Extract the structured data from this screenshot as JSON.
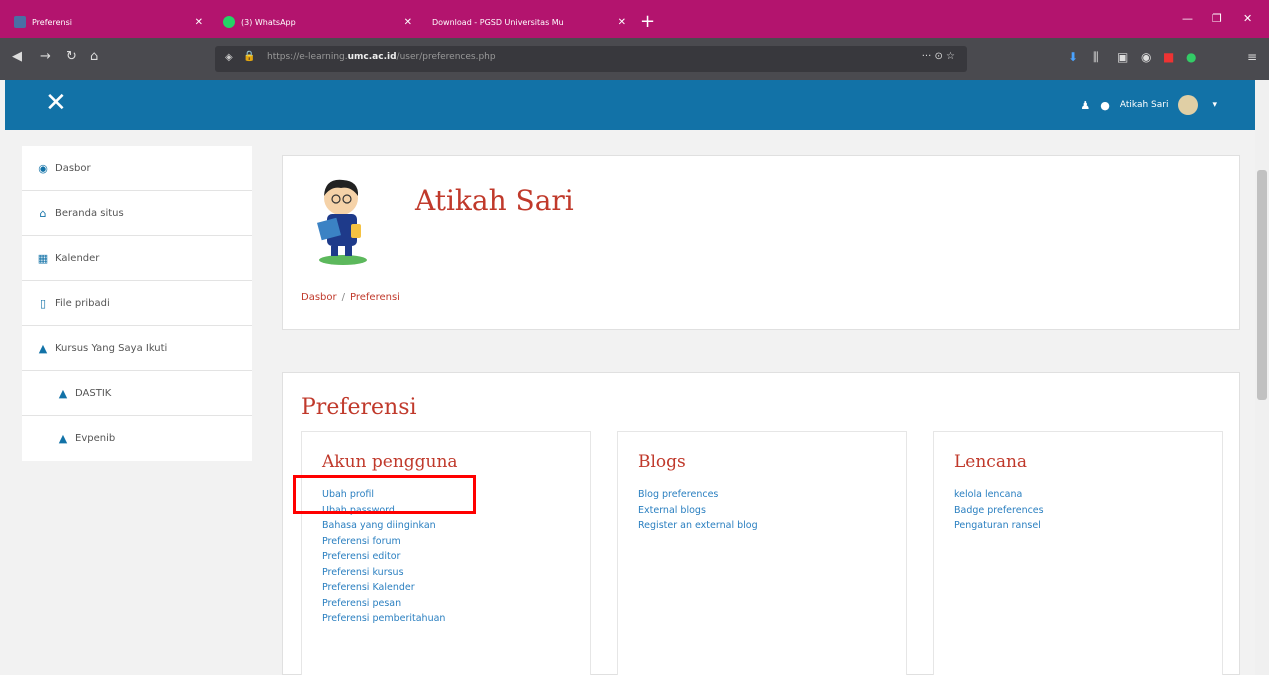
{
  "browser": {
    "tabs": [
      {
        "title": "Preferensi",
        "active": false
      },
      {
        "title": "(3) WhatsApp",
        "active": false
      },
      {
        "title": "Download - PGSD Universitas Mu",
        "active": true
      }
    ],
    "url_prefix": "https://e-learning.",
    "url_domain": "umc.ac.id",
    "url_path": "/user/preferences.php",
    "url_actions": "··· ⊙ ☆"
  },
  "header": {
    "user_name": "Atikah Sari"
  },
  "sidebar": {
    "items": [
      {
        "label": "Dasbor",
        "icon": "dashboard-icon",
        "glyph": "◉"
      },
      {
        "label": "Beranda situs",
        "icon": "home-icon",
        "glyph": "⌂"
      },
      {
        "label": "Kalender",
        "icon": "calendar-icon",
        "glyph": "▦"
      },
      {
        "label": "File pribadi",
        "icon": "file-icon",
        "glyph": "▯"
      },
      {
        "label": "Kursus Yang Saya Ikuti",
        "icon": "graduation-cap-icon",
        "glyph": "▲"
      },
      {
        "label": "DASTIK",
        "icon": "graduation-cap-icon",
        "glyph": "▲"
      },
      {
        "label": "Evpenib",
        "icon": "graduation-cap-icon",
        "glyph": "▲"
      }
    ]
  },
  "page": {
    "user_name": "Atikah Sari",
    "breadcrumb": [
      "Dasbor",
      "Preferensi"
    ],
    "title": "Preferensi"
  },
  "sections": {
    "account": {
      "title": "Akun pengguna",
      "links": [
        "Ubah profil",
        "Ubah password",
        "Bahasa yang diinginkan",
        "Preferensi forum",
        "Preferensi editor",
        "Preferensi kursus",
        "Preferensi Kalender",
        "Preferensi pesan",
        "Preferensi pemberitahuan"
      ]
    },
    "blogs": {
      "title": "Blogs",
      "links": [
        "Blog preferences",
        "External blogs",
        "Register an external blog"
      ]
    },
    "badges": {
      "title": "Lencana",
      "links": [
        "kelola lencana",
        "Badge preferences",
        "Pengaturan ransel"
      ]
    }
  },
  "colors": {
    "accent": "#b3146e",
    "header": "#1272a7",
    "title": "#c0392b",
    "link": "#2a7fc0"
  }
}
